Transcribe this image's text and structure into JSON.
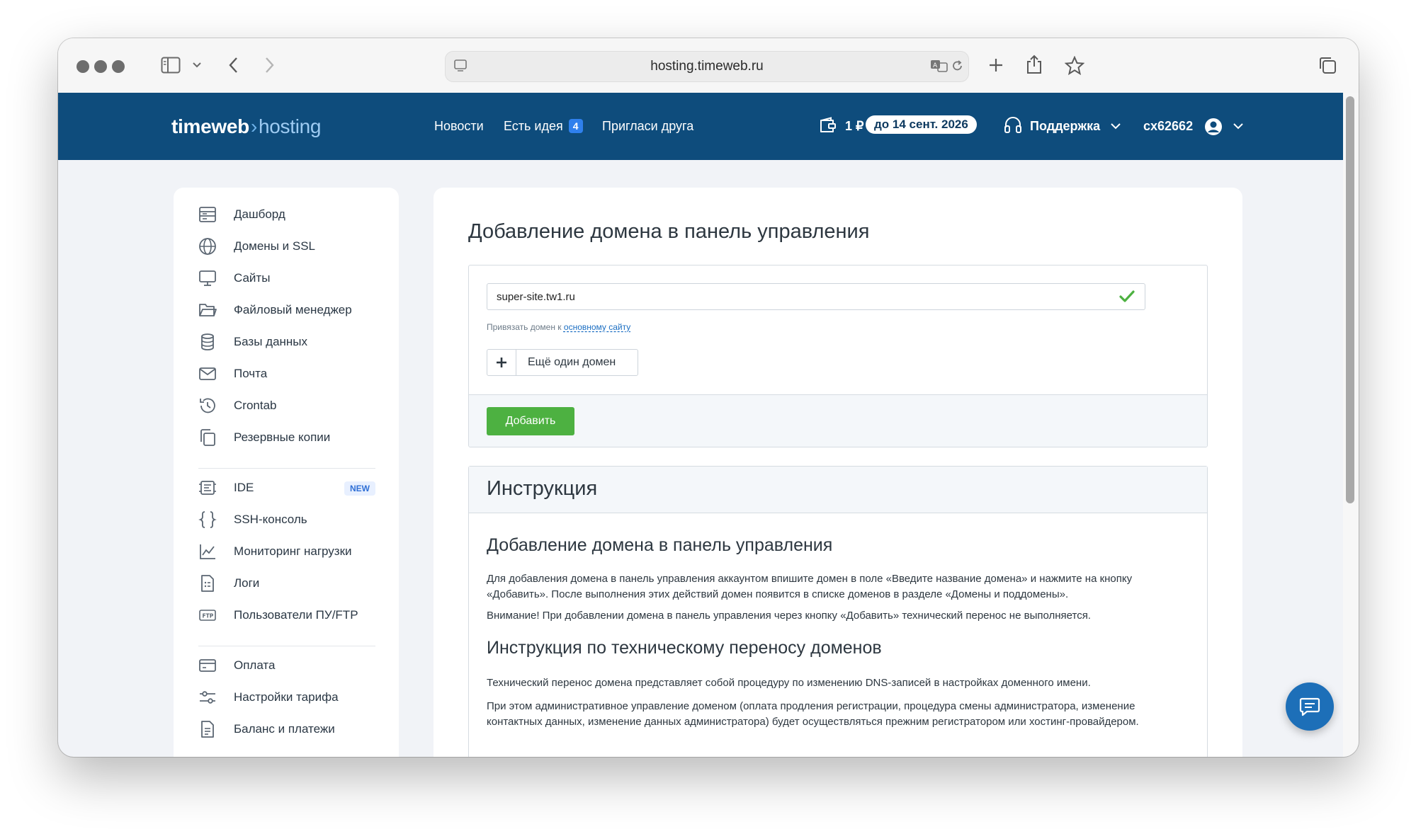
{
  "browser": {
    "url": "hosting.timeweb.ru"
  },
  "header": {
    "logo_main": "timeweb",
    "logo_sep": "›",
    "logo_sub": "hosting",
    "nav": {
      "news": "Новости",
      "idea": "Есть идея",
      "idea_count": "4",
      "invite": "Пригласи друга"
    },
    "balance": "1 ₽",
    "paid_until": "до 14 сент. 2026",
    "support": "Поддержка",
    "account": "cx62662"
  },
  "sidebar": {
    "group1": [
      {
        "label": "Дашборд",
        "icon": "dashboard-icon"
      },
      {
        "label": "Домены и SSL",
        "icon": "globe-icon"
      },
      {
        "label": "Сайты",
        "icon": "monitor-icon"
      },
      {
        "label": "Файловый менеджер",
        "icon": "folder-icon"
      },
      {
        "label": "Базы данных",
        "icon": "database-icon"
      },
      {
        "label": "Почта",
        "icon": "mail-icon"
      },
      {
        "label": "Crontab",
        "icon": "history-icon"
      },
      {
        "label": "Резервные копии",
        "icon": "copies-icon"
      }
    ],
    "group2": [
      {
        "label": "IDE",
        "icon": "ide-icon",
        "badge": "NEW"
      },
      {
        "label": "SSH-консоль",
        "icon": "braces-icon"
      },
      {
        "label": "Мониторинг нагрузки",
        "icon": "chart-line-icon"
      },
      {
        "label": "Логи",
        "icon": "log-file-icon"
      },
      {
        "label": "Пользователи ПУ/FTP",
        "icon": "ftp-icon"
      }
    ],
    "group3": [
      {
        "label": "Оплата",
        "icon": "card-icon"
      },
      {
        "label": "Настройки тарифа",
        "icon": "sliders-icon"
      },
      {
        "label": "Баланс и платежи",
        "icon": "document-icon"
      }
    ]
  },
  "main": {
    "title": "Добавление домена в панель управления",
    "form": {
      "domain_value": "super-site.tw1.ru",
      "hint_prefix": "Привязать домен к",
      "hint_link": "основному сайту",
      "add_more": "Ещё один домен",
      "submit": "Добавить"
    },
    "instructions": {
      "title": "Инструкция",
      "section1_title": "Добавление домена в панель управления",
      "section1_p1": "Для добавления домена в панель управления аккаунтом впишите домен в поле «Введите название домена» и нажмите на кнопку «Добавить». После выполнения этих действий домен появится в списке доменов в разделе «Домены и поддомены».",
      "section1_p2": "Внимание! При добавлении домена в панель управления через кнопку «Добавить» технический перенос не выполняется.",
      "section2_title": "Инструкция по техническому переносу доменов",
      "section2_p1": "Технический перенос домена представляет собой процедуру по изменению DNS-записей в настройках доменного имени.",
      "section2_p2": "При этом административное управление доменом (оплата продления регистрации, процедура смены администратора, изменение контактных данных, изменение данных администратора) будет осуществляться прежним регистратором или хостинг-провайдером."
    }
  },
  "colors": {
    "header_bg": "#0e4c7c",
    "accent_blue": "#2f80ed",
    "success_green": "#4db141",
    "chat_blue": "#1d6fb8"
  }
}
